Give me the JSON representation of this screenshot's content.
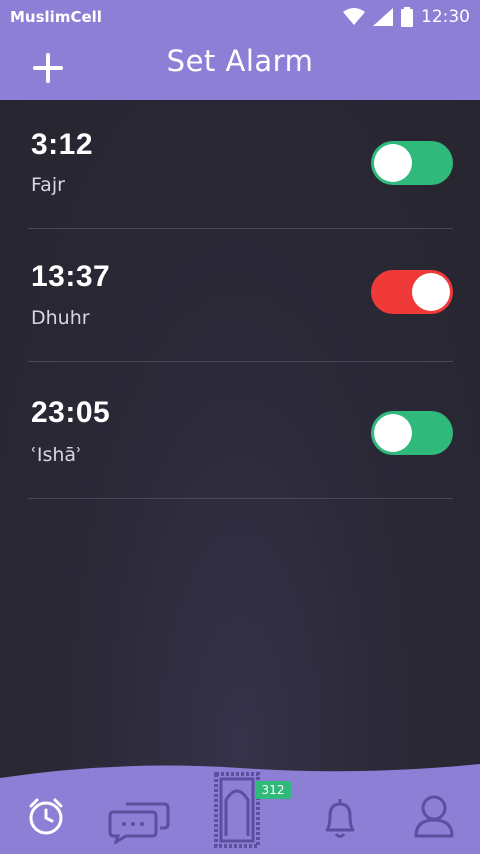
{
  "status_bar": {
    "carrier": "MuslimCell",
    "time": "12:30"
  },
  "header": {
    "title": "Set Alarm",
    "add_icon": "plus-icon"
  },
  "alarms": [
    {
      "time": "3:12",
      "name": "Fajr",
      "enabled": true,
      "toggle_color": "#2fb97b"
    },
    {
      "time": "13:37",
      "name": "Dhuhr",
      "enabled": false,
      "toggle_color": "#f03a3a"
    },
    {
      "time": "23:05",
      "name": "ʿIshāʾ",
      "enabled": true,
      "toggle_color": "#2fb97b"
    }
  ],
  "bottom_nav": {
    "items": [
      {
        "icon": "alarm-clock-icon",
        "active": true
      },
      {
        "icon": "chat-bubbles-icon",
        "active": false
      },
      {
        "icon": "prayer-mat-icon",
        "active": false
      },
      {
        "icon": "bell-icon",
        "active": false
      },
      {
        "icon": "profile-icon",
        "active": false
      }
    ],
    "badge": "312"
  },
  "colors": {
    "header": "#8d7ed6",
    "background": "#2a2834",
    "toggle_on": "#2fb97b",
    "toggle_off": "#f03a3a"
  }
}
